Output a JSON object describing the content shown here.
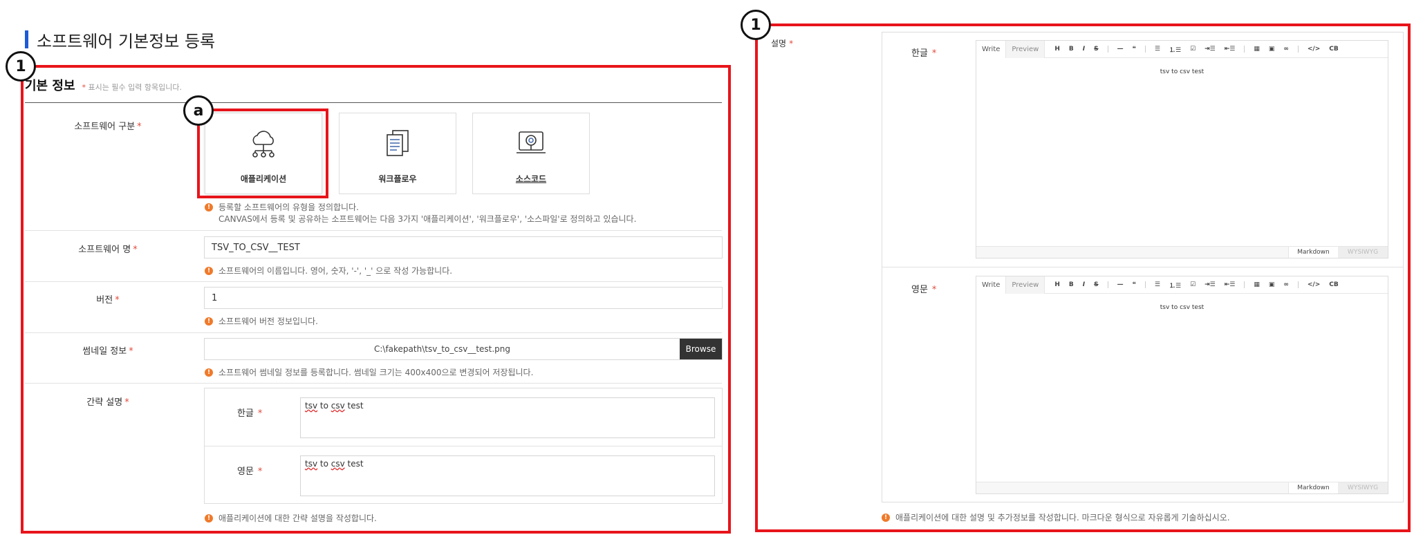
{
  "page_title": "소프트웨어 기본정보 등록",
  "callouts": {
    "left": "1",
    "card": "a",
    "right": "1"
  },
  "basic_info": {
    "title": "기본 정보",
    "required_note": "표시는 필수 입력 항목입니다.",
    "required_mark": "*"
  },
  "software_type": {
    "label": "소프트웨어 구분",
    "options": [
      {
        "label": "애플리케이션",
        "icon": "cloud-network-icon",
        "selected": true
      },
      {
        "label": "워크플로우",
        "icon": "documents-icon",
        "selected": false
      },
      {
        "label": "소스코드",
        "icon": "monitor-search-icon",
        "selected": false
      }
    ],
    "hint_line1": "등록할 소프트웨어의 유형을 정의합니다.",
    "hint_line2": "CANVAS에서 등록 및 공유하는 소프트웨어는 다음 3가지 '애플리케이션', '워크플로우', '소스파일'로 정의하고 있습니다."
  },
  "software_name": {
    "label": "소프트웨어 명",
    "value": "TSV_TO_CSV__TEST",
    "hint": "소프트웨어의 이름입니다. 영어, 숫자, '-', '_' 으로 작성 가능합니다."
  },
  "version": {
    "label": "버전",
    "value": "1",
    "hint": "소프트웨어 버전 정보입니다."
  },
  "thumbnail": {
    "label": "썸네일 정보",
    "path": "C:\\fakepath\\tsv_to_csv__test.png",
    "browse_label": "Browse",
    "hint": "소프트웨어 썸네일 정보를 등록합니다. 썸네일 크기는 400x400으로 변경되어 저장됩니다."
  },
  "brief": {
    "label": "간략 설명",
    "ko_label": "한글",
    "en_label": "영문",
    "ko_value_w1": "tsv",
    "ko_value_w2": " to ",
    "ko_value_w3": "csv",
    "ko_value_w4": " test",
    "en_value_w1": "tsv",
    "en_value_w2": " to ",
    "en_value_w3": "csv",
    "en_value_w4": " test",
    "hint": "애플리케이션에 대한 간략 설명을 작성합니다."
  },
  "description": {
    "label": "설명",
    "ko_label": "한글",
    "en_label": "영문",
    "editor": {
      "tab_write": "Write",
      "tab_preview": "Preview",
      "tools": [
        "H",
        "B",
        "I",
        "S",
        "—",
        "❝",
        "☰",
        "⒈☰",
        "☑",
        "⇥☰",
        "⇤☰",
        "▦",
        "▣",
        "∞",
        "</>",
        "CB"
      ],
      "mode_markdown": "Markdown",
      "mode_wysiwyg": "WYSIWYG"
    },
    "ko_content": "tsv to csv test",
    "en_content": "tsv to csv test",
    "hint": "애플리케이션에 대한 설명 및 추가정보를 작성합니다. 마크다운 형식으로 자유롭게 기술하십시오."
  },
  "colors": {
    "accent_bar": "#1d5bd6",
    "callout_box": "#e8141b",
    "required_star": "#e34b3c",
    "hint_dot": "#ef7a2a",
    "browse_button": "#333333"
  }
}
